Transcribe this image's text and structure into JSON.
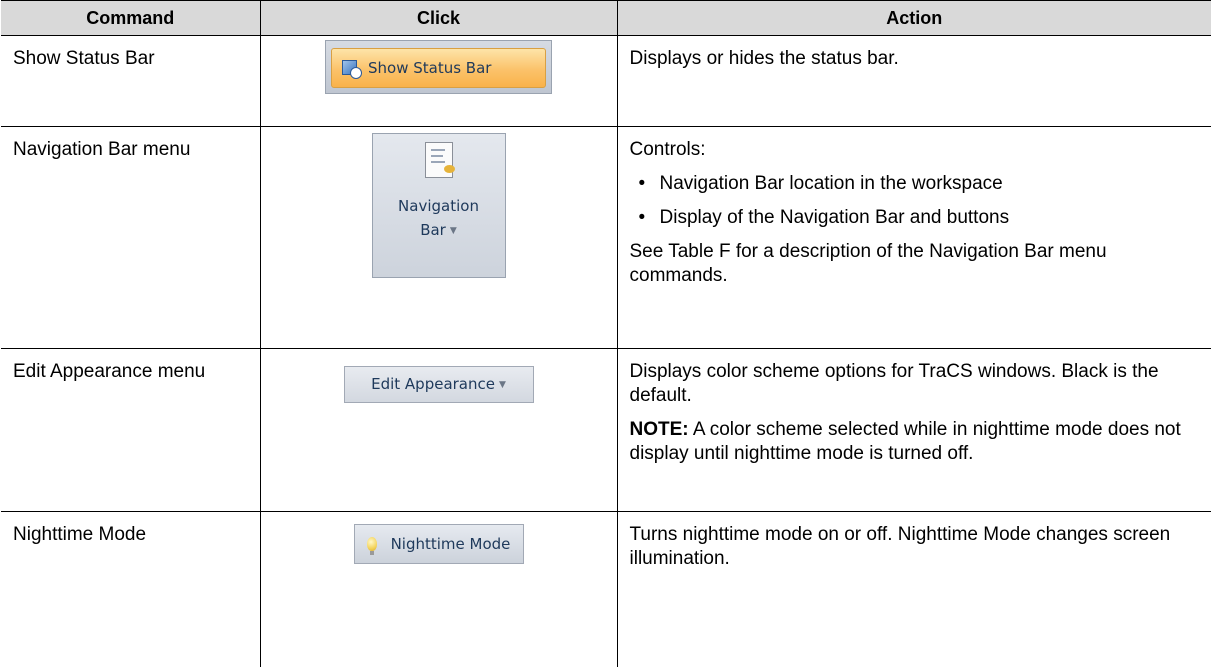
{
  "header": {
    "command": "Command",
    "click": "Click",
    "action": "Action"
  },
  "rows": [
    {
      "command": "Show Status Bar",
      "button": {
        "label": "Show Status Bar",
        "icon": "status-bar-icon"
      },
      "action": [
        "Displays or hides the status bar."
      ]
    },
    {
      "command": "Navigation Bar menu",
      "button": {
        "label_line1": "Navigation",
        "label_line2": "Bar",
        "icon": "document-icon"
      },
      "action_intro": "Controls:",
      "bullets": [
        "Navigation Bar location in the workspace",
        "Display of the Navigation Bar and buttons"
      ],
      "action_outro": "See Table F for a description of the Navigation Bar menu commands."
    },
    {
      "command": "Edit Appearance menu",
      "button": {
        "label": "Edit Appearance"
      },
      "action": "Displays color scheme options for TraCS windows. Black is the default.",
      "note_label": "NOTE:",
      "note_text": " A color scheme selected while in nighttime mode does not display until nighttime mode is turned off."
    },
    {
      "command": "Nighttime Mode",
      "button": {
        "label": "Nighttime Mode",
        "icon": "lightbulb-icon"
      },
      "action": "Turns nighttime mode on or off. Nighttime Mode changes screen illumination."
    }
  ],
  "colors": {
    "header_bg": "#d9d9d9",
    "ribbon_text": "#1e395b",
    "highlight": "#fbc26a"
  }
}
